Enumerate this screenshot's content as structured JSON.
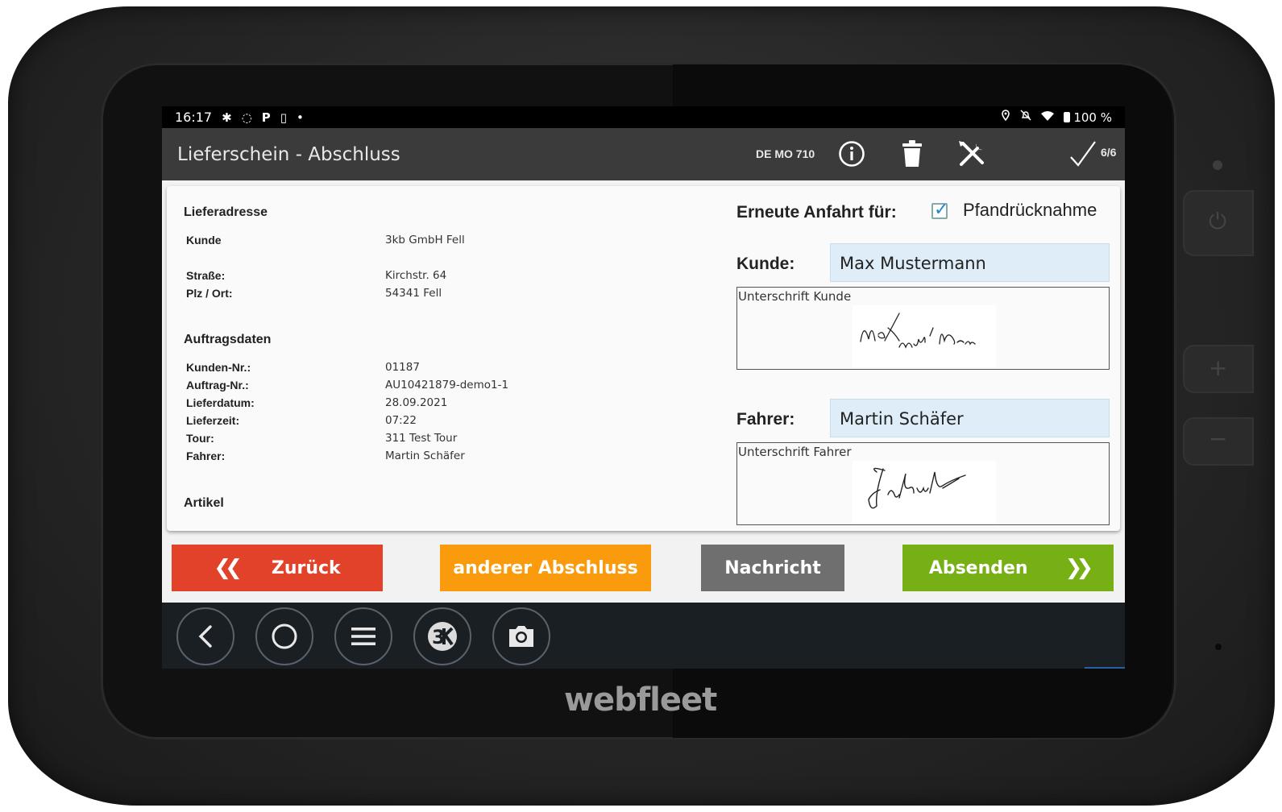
{
  "device": {
    "brand": "webfleet"
  },
  "status_bar": {
    "time": "16:17",
    "battery_percent": "100 %",
    "icons_left": [
      "settings-icon",
      "sync-icon",
      "parking-icon",
      "battery-small-icon",
      "dot-icon"
    ],
    "icons_right": [
      "location-icon",
      "alarm-off-icon",
      "wifi-icon",
      "battery-icon"
    ]
  },
  "app_bar": {
    "title": "Lieferschein - Abschluss",
    "vehicle_plate": "DE MO 710",
    "progress": "6/6",
    "icons": [
      "info-icon",
      "trash-icon",
      "tools-icon",
      "checkmark-icon"
    ]
  },
  "delivery": {
    "address_title": "Lieferadresse",
    "customer_label": "Kunde",
    "customer_value": "3kb GmbH Fell",
    "street_label": "Straße:",
    "street_value": "Kirchstr. 64",
    "city_label": "Plz / Ort:",
    "city_value": "54341 Fell",
    "order_title": "Auftragsdaten",
    "order_fields": [
      {
        "label": "Kunden-Nr.:",
        "value": "01187"
      },
      {
        "label": "Auftrag-Nr.:",
        "value": "AU10421879-demo1-1"
      },
      {
        "label": "Lieferdatum:",
        "value": "28.09.2021"
      },
      {
        "label": "Lieferzeit:",
        "value": "07:22"
      },
      {
        "label": "Tour:",
        "value": "311 Test Tour"
      },
      {
        "label": "Fahrer:",
        "value": "Martin Schäfer"
      }
    ],
    "articles_title": "Artikel"
  },
  "completion": {
    "revisit_label": "Erneute Anfahrt für:",
    "revisit_option": "Pfandrücknahme",
    "revisit_checked": true,
    "customer_label": "Kunde:",
    "customer_name": "Max Mustermann",
    "customer_signature_caption": "Unterschrift Kunde",
    "driver_label": "Fahrer:",
    "driver_name": "Martin Schäfer",
    "driver_signature_caption": "Unterschrift Fahrer"
  },
  "actions": {
    "back": {
      "label": "Zurück",
      "color": "#e2412a"
    },
    "other_completion": {
      "label": "anderer Abschluss",
      "color": "#f99b0c"
    },
    "message": {
      "label": "Nachricht",
      "color": "#6f6f6f"
    },
    "send": {
      "label": "Absenden",
      "color": "#76b015"
    }
  },
  "nav_bar": {
    "buttons": [
      "back-nav-icon",
      "home-nav-icon",
      "menu-nav-icon",
      "app-3k-icon",
      "camera-icon"
    ]
  }
}
